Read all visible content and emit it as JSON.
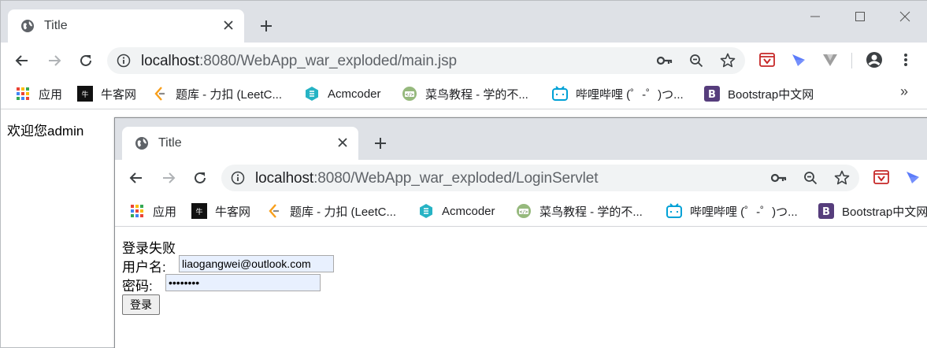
{
  "outer": {
    "tab": {
      "title": "Title"
    },
    "address": {
      "host": "localhost",
      "path": ":8080/WebApp_war_exploded/main.jsp"
    },
    "bookmarks": [
      {
        "label": "应用",
        "icon": "apps-grid-icon"
      },
      {
        "label": "牛客网",
        "icon": "nowcoder-icon"
      },
      {
        "label": "题库 - 力扣 (LeetC...",
        "icon": "leetcode-icon"
      },
      {
        "label": "Acmcoder",
        "icon": "acmcoder-icon"
      },
      {
        "label": "菜鸟教程 - 学的不...",
        "icon": "runoob-icon"
      },
      {
        "label": "哔哩哔哩 (゜-゜)つ...",
        "icon": "bilibili-icon"
      },
      {
        "label": "Bootstrap中文网",
        "icon": "bootstrap-icon"
      }
    ],
    "bookmarks_more": "»",
    "page": {
      "welcome": "欢迎您admin"
    }
  },
  "inner": {
    "tab": {
      "title": "Title"
    },
    "address": {
      "host": "localhost",
      "path": ":8080/WebApp_war_exploded/LoginServlet"
    },
    "bookmarks": [
      {
        "label": "应用",
        "icon": "apps-grid-icon"
      },
      {
        "label": "牛客网",
        "icon": "nowcoder-icon"
      },
      {
        "label": "题库 - 力扣 (LeetC...",
        "icon": "leetcode-icon"
      },
      {
        "label": "Acmcoder",
        "icon": "acmcoder-icon"
      },
      {
        "label": "菜鸟教程 - 学的不...",
        "icon": "runoob-icon"
      },
      {
        "label": "哔哩哔哩 (゜-゜)つ...",
        "icon": "bilibili-icon"
      },
      {
        "label": "Bootstrap中文网",
        "icon": "bootstrap-icon"
      }
    ],
    "page": {
      "status": "登录失败",
      "username_label": "用户名:",
      "username_value": "liaogangwei@outlook.com",
      "password_label": "密码:",
      "password_value": "••••••••",
      "submit_label": "登录"
    }
  },
  "colors": {
    "tabstrip": "#dee1e6",
    "omnibox": "#f1f3f4",
    "autofill": "#e8f0fe"
  }
}
